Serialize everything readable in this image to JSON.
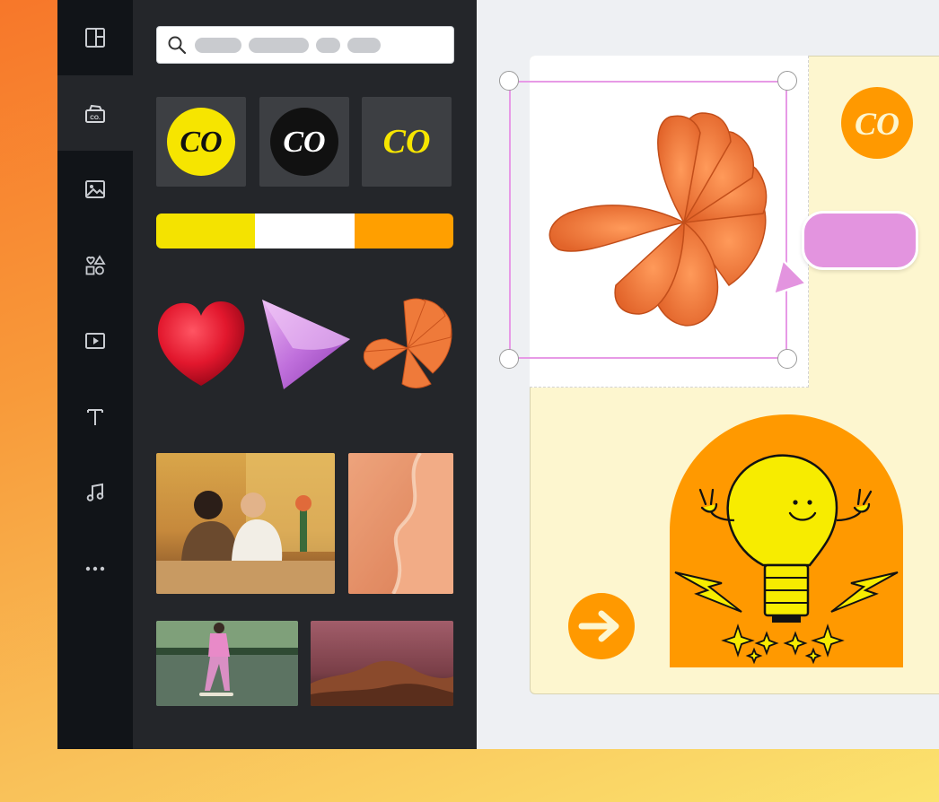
{
  "sidebar": {
    "items": [
      {
        "id": "layout",
        "icon": "layout-icon",
        "active": false
      },
      {
        "id": "brand",
        "icon": "brand-kit-icon",
        "active": true,
        "icon_text": "CO."
      },
      {
        "id": "photos",
        "icon": "image-icon",
        "active": false
      },
      {
        "id": "elements",
        "icon": "shapes-icon",
        "active": false
      },
      {
        "id": "videos",
        "icon": "video-icon",
        "active": false
      },
      {
        "id": "text",
        "icon": "text-icon",
        "active": false
      },
      {
        "id": "audio",
        "icon": "music-icon",
        "active": false
      },
      {
        "id": "more",
        "icon": "more-dots-icon",
        "active": false
      }
    ]
  },
  "panel": {
    "search": {
      "icon": "search-icon"
    },
    "logos": [
      {
        "text": "CO",
        "bg": "#f6e500",
        "fg": "#111111"
      },
      {
        "text": "CO",
        "bg": "#111111",
        "fg": "#ffffff"
      },
      {
        "text": "CO",
        "bg": "none",
        "fg": "#f6e500"
      }
    ],
    "palette": [
      "#f4e300",
      "#ffffff",
      "#ff9f00"
    ],
    "graphics": [
      "fuzzy-heart-graphic",
      "purple-cone-graphic",
      "orange-fan-graphic"
    ],
    "photos": [
      "couple-dining-photo",
      "beach-shoreline-photo",
      "skateboarder-photo",
      "desert-rocks-photo"
    ]
  },
  "canvas": {
    "logo_badge": {
      "text": "CO",
      "bg": "#ff9900"
    },
    "colors": {
      "page": "#fdf6cf",
      "selection": "#e79ae6",
      "bubble": "#e394df",
      "accent": "#ff9900",
      "bulb": "#f7ec00"
    }
  }
}
